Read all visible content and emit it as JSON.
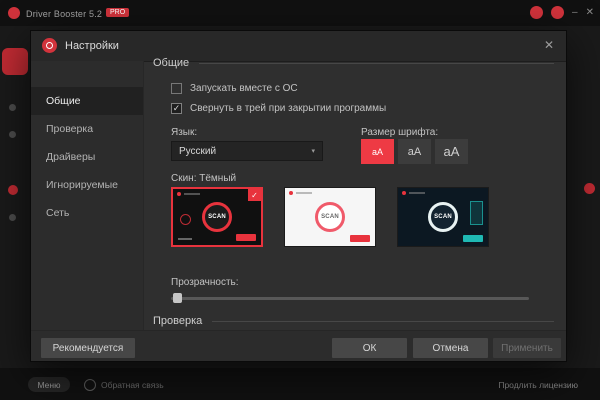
{
  "icons": {
    "check": "✓",
    "caret_down": "▾",
    "close": "✕",
    "minimize": "–"
  },
  "window": {
    "title": "Driver Booster 5.2",
    "pro_badge": "PRO",
    "statusbar": {
      "menu_label": "Меню",
      "info_text": "Обратная связь",
      "license_text": "Продлить лицензию"
    }
  },
  "dialog": {
    "title": "Настройки",
    "sidebar": [
      {
        "label": "Общие",
        "selected": true
      },
      {
        "label": "Проверка",
        "selected": false
      },
      {
        "label": "Драйверы",
        "selected": false
      },
      {
        "label": "Игнорируемые",
        "selected": false
      },
      {
        "label": "Сеть",
        "selected": false
      }
    ],
    "general": {
      "heading": "Общие",
      "autostart": {
        "label": "Запускать вместе с ОС",
        "checked": false
      },
      "tray": {
        "label": "Свернуть в трей при закрытии программы",
        "checked": true
      },
      "language_label": "Язык:",
      "language_value": "Русский",
      "font_size_label": "Размер шрифта:",
      "font_sizes": [
        {
          "label": "аА",
          "selected": true
        },
        {
          "label": "аА",
          "selected": false
        },
        {
          "label": "аА",
          "selected": false
        }
      ],
      "skin_label": "Скин: Тёмный",
      "skins": [
        {
          "scan_label": "SCAN",
          "selected": true,
          "bg": "#101010",
          "ring": "#e8333d",
          "ring_fill": "#1b1b1b",
          "text": "#ffffff",
          "button": "#e8333d"
        },
        {
          "scan_label": "SCAN",
          "selected": false,
          "bg": "#f6f6f6",
          "ring": "#f05a6a",
          "ring_fill": "#ffffff",
          "text": "#666666",
          "button": "#e8333d"
        },
        {
          "scan_label": "SCAN",
          "selected": false,
          "bg": "#0c1822",
          "ring": "#e9f3f3",
          "ring_fill": "#132330",
          "text": "#ffffff",
          "button": "#1fb9b4"
        }
      ],
      "transparency_label": "Прозрачность:",
      "transparency_percent": 1
    },
    "next_heading": "Проверка",
    "buttons": {
      "recommended": "Рекомендуется",
      "ok": "ОК",
      "cancel": "Отмена",
      "apply": "Применить"
    }
  },
  "colors": {
    "accent": "#e8333d"
  }
}
